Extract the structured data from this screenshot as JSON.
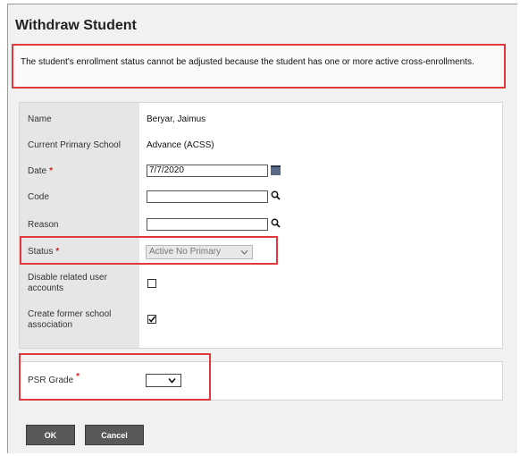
{
  "dialog": {
    "title": "Withdraw Student",
    "message": "The student's enrollment status cannot be adjusted because the student has one or more active cross-enrollments."
  },
  "form": {
    "name": {
      "label": "Name",
      "value": "Beryar, Jaimus"
    },
    "primary_school": {
      "label": "Current Primary School",
      "value": "Advance (ACSS)"
    },
    "date": {
      "label": "Date",
      "value": "7/7/2020",
      "required_mark": "*"
    },
    "code": {
      "label": "Code",
      "value": ""
    },
    "reason": {
      "label": "Reason",
      "value": ""
    },
    "status": {
      "label": "Status",
      "value": "Active No Primary",
      "required_mark": "*"
    },
    "disable_accounts": {
      "label": "Disable related user accounts",
      "checked": false
    },
    "former_school": {
      "label": "Create former school association",
      "checked": true
    }
  },
  "psr": {
    "label": "PSR Grade",
    "required_mark": "*",
    "value": ""
  },
  "buttons": {
    "ok": "OK",
    "cancel": "Cancel"
  },
  "colors": {
    "highlight": "#e0383c",
    "button": "#595959",
    "required": "#d42020"
  },
  "icons": [
    "calendar-icon",
    "magnifier-icon",
    "chevron-down-icon",
    "checkmark-icon"
  ]
}
